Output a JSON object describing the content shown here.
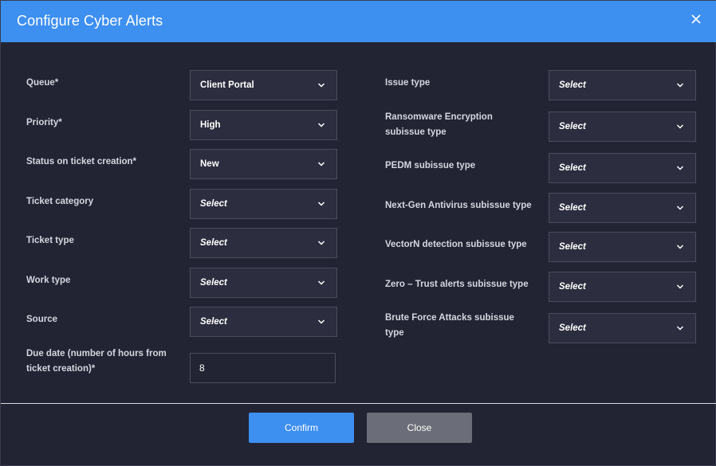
{
  "dialog": {
    "title": "Configure Cyber Alerts",
    "close_icon": "close-icon"
  },
  "left_fields": [
    {
      "label": "Queue*",
      "value": "Client Portal",
      "placeholder": false
    },
    {
      "label": "Priority*",
      "value": "High",
      "placeholder": false
    },
    {
      "label": "Status on ticket creation*",
      "value": "New",
      "placeholder": false
    },
    {
      "label": "Ticket category",
      "value": "Select",
      "placeholder": true
    },
    {
      "label": "Ticket type",
      "value": "Select",
      "placeholder": true
    },
    {
      "label": "Work type",
      "value": "Select",
      "placeholder": true
    },
    {
      "label": "Source",
      "value": "Select",
      "placeholder": true
    }
  ],
  "due_date": {
    "label": "Due date (number of hours from ticket creation)*",
    "value": "8"
  },
  "right_fields": [
    {
      "label": "Issue type",
      "value": "Select"
    },
    {
      "label": "Ransomware Encryption subissue type",
      "value": "Select"
    },
    {
      "label": "PEDM subissue type",
      "value": "Select"
    },
    {
      "label": "Next-Gen Antivirus subissue type",
      "value": "Select"
    },
    {
      "label": "VectorN detection subissue type",
      "value": "Select"
    },
    {
      "label": "Zero – Trust alerts subissue type",
      "value": "Select"
    },
    {
      "label": "Brute Force Attacks subissue type",
      "value": "Select"
    }
  ],
  "footer": {
    "confirm_label": "Confirm",
    "close_label": "Close"
  },
  "colors": {
    "header": "#3d8ff0",
    "background": "#232433",
    "field": "#2c2d3e",
    "close_button": "#6b6e78"
  }
}
